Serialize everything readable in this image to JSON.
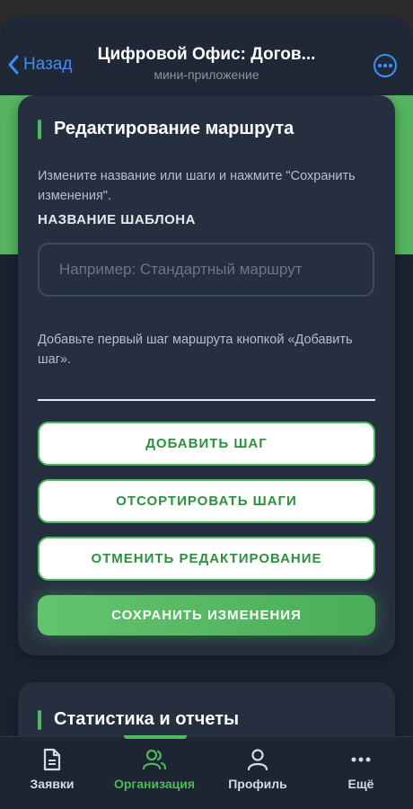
{
  "navbar": {
    "back_label": "Назад",
    "title": "Цифровой Офис: Догов...",
    "subtitle": "мини-приложение",
    "more_icon": "more-dots-icon"
  },
  "route_editor": {
    "title": "Редактирование маршрута",
    "hint": "Измените название или шаги и нажмите \"Сохранить изменения\".",
    "template_name_label": "НАЗВАНИЕ ШАБЛОНА",
    "template_name_value": "",
    "template_name_placeholder": "Например: Стандартный маршрут",
    "empty_steps_hint": "Добавьте первый шаг маршрута кнопкой «Добавить шаг».",
    "buttons": {
      "add_step": "ДОБАВИТЬ ШАГ",
      "sort_steps": "ОТСОРТИРОВАТЬ ШАГИ",
      "cancel_edit": "ОТМЕНИТЬ РЕДАКТИРОВАНИЕ",
      "save_changes": "СОХРАНИТЬ ИЗМЕНЕНИЯ"
    }
  },
  "stats": {
    "title": "Статистика и отчеты"
  },
  "tabbar": {
    "active_tab": "Организация",
    "items": [
      {
        "label": "Заявки",
        "icon": "document-icon"
      },
      {
        "label": "Организация",
        "icon": "users-icon"
      },
      {
        "label": "Профиль",
        "icon": "user-icon"
      },
      {
        "label": "Ещё",
        "icon": "more-dots-icon"
      }
    ]
  },
  "colors": {
    "accent_green": "#4cbb5d",
    "ios_blue": "#3d8ff5",
    "card_bg": "#262f3f",
    "page_bg": "#1c2330"
  }
}
